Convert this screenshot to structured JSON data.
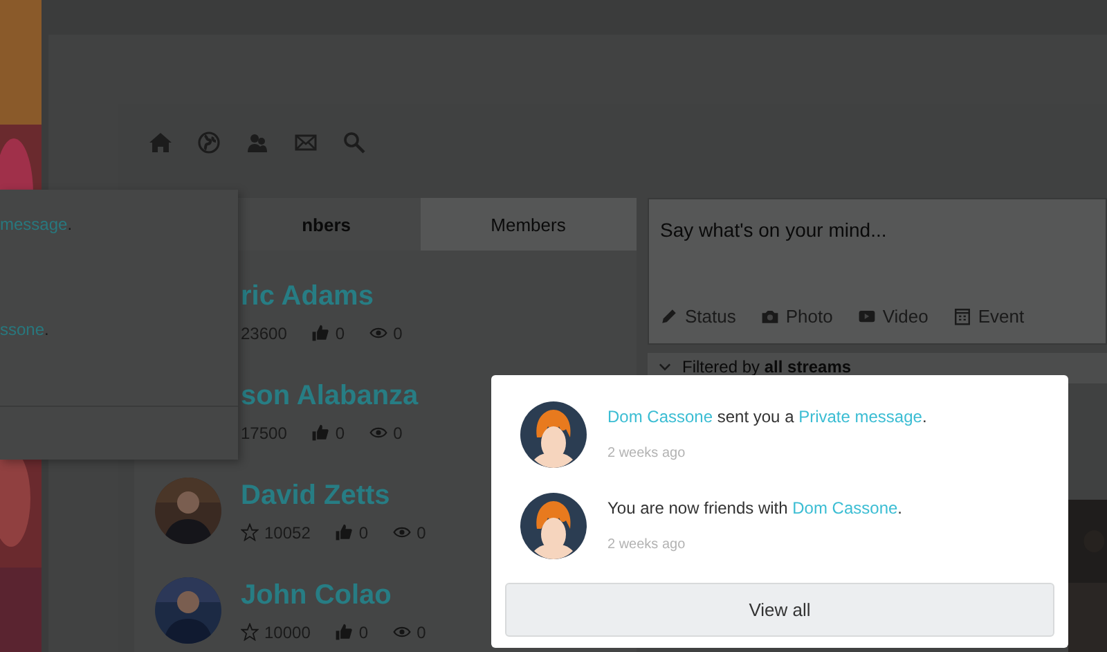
{
  "background_popup": {
    "items": [
      {
        "link": "message",
        "after": "."
      },
      {
        "link": "ssone",
        "after": "."
      }
    ]
  },
  "tabs": [
    {
      "label": "nbers",
      "selected": true
    },
    {
      "label": "Members",
      "selected": false
    }
  ],
  "members": [
    {
      "kind": "covered",
      "name": "ric Adams",
      "points": "23600",
      "likes": "0",
      "views": "0"
    },
    {
      "kind": "covered",
      "name": "son Alabanza",
      "points": "17500",
      "likes": "0",
      "views": "0"
    },
    {
      "kind": "full",
      "name": "David Zetts",
      "points": "10052",
      "likes": "0",
      "views": "0"
    },
    {
      "kind": "full",
      "name": "John Colao",
      "points": "10000",
      "likes": "0",
      "views": "0"
    }
  ],
  "composer": {
    "placeholder": "Say what's on your mind...",
    "actions": [
      {
        "kind": "status",
        "label": "Status"
      },
      {
        "label": "Photo"
      },
      {
        "kind": "video",
        "label": "Video"
      },
      {
        "kind": "event",
        "label": "Event"
      }
    ]
  },
  "filter": {
    "label": "Filtered by **all streams**"
  },
  "notifications": {
    "items": [
      {
        "parts": [
          {
            "text": "Dom Cassone",
            "link": true
          },
          {
            "text": " sent you a ",
            "link": false
          },
          {
            "text": "Private message",
            "link": true
          },
          {
            "text": ".",
            "link": false
          }
        ],
        "time": "2 weeks ago"
      },
      {
        "parts": [
          {
            "text": "You are now friends with ",
            "link": false
          },
          {
            "text": "Dom Cassone",
            "link": true
          },
          {
            "text": ".",
            "link": false
          }
        ],
        "time": "2 weeks ago"
      }
    ],
    "view_all": "View all"
  }
}
